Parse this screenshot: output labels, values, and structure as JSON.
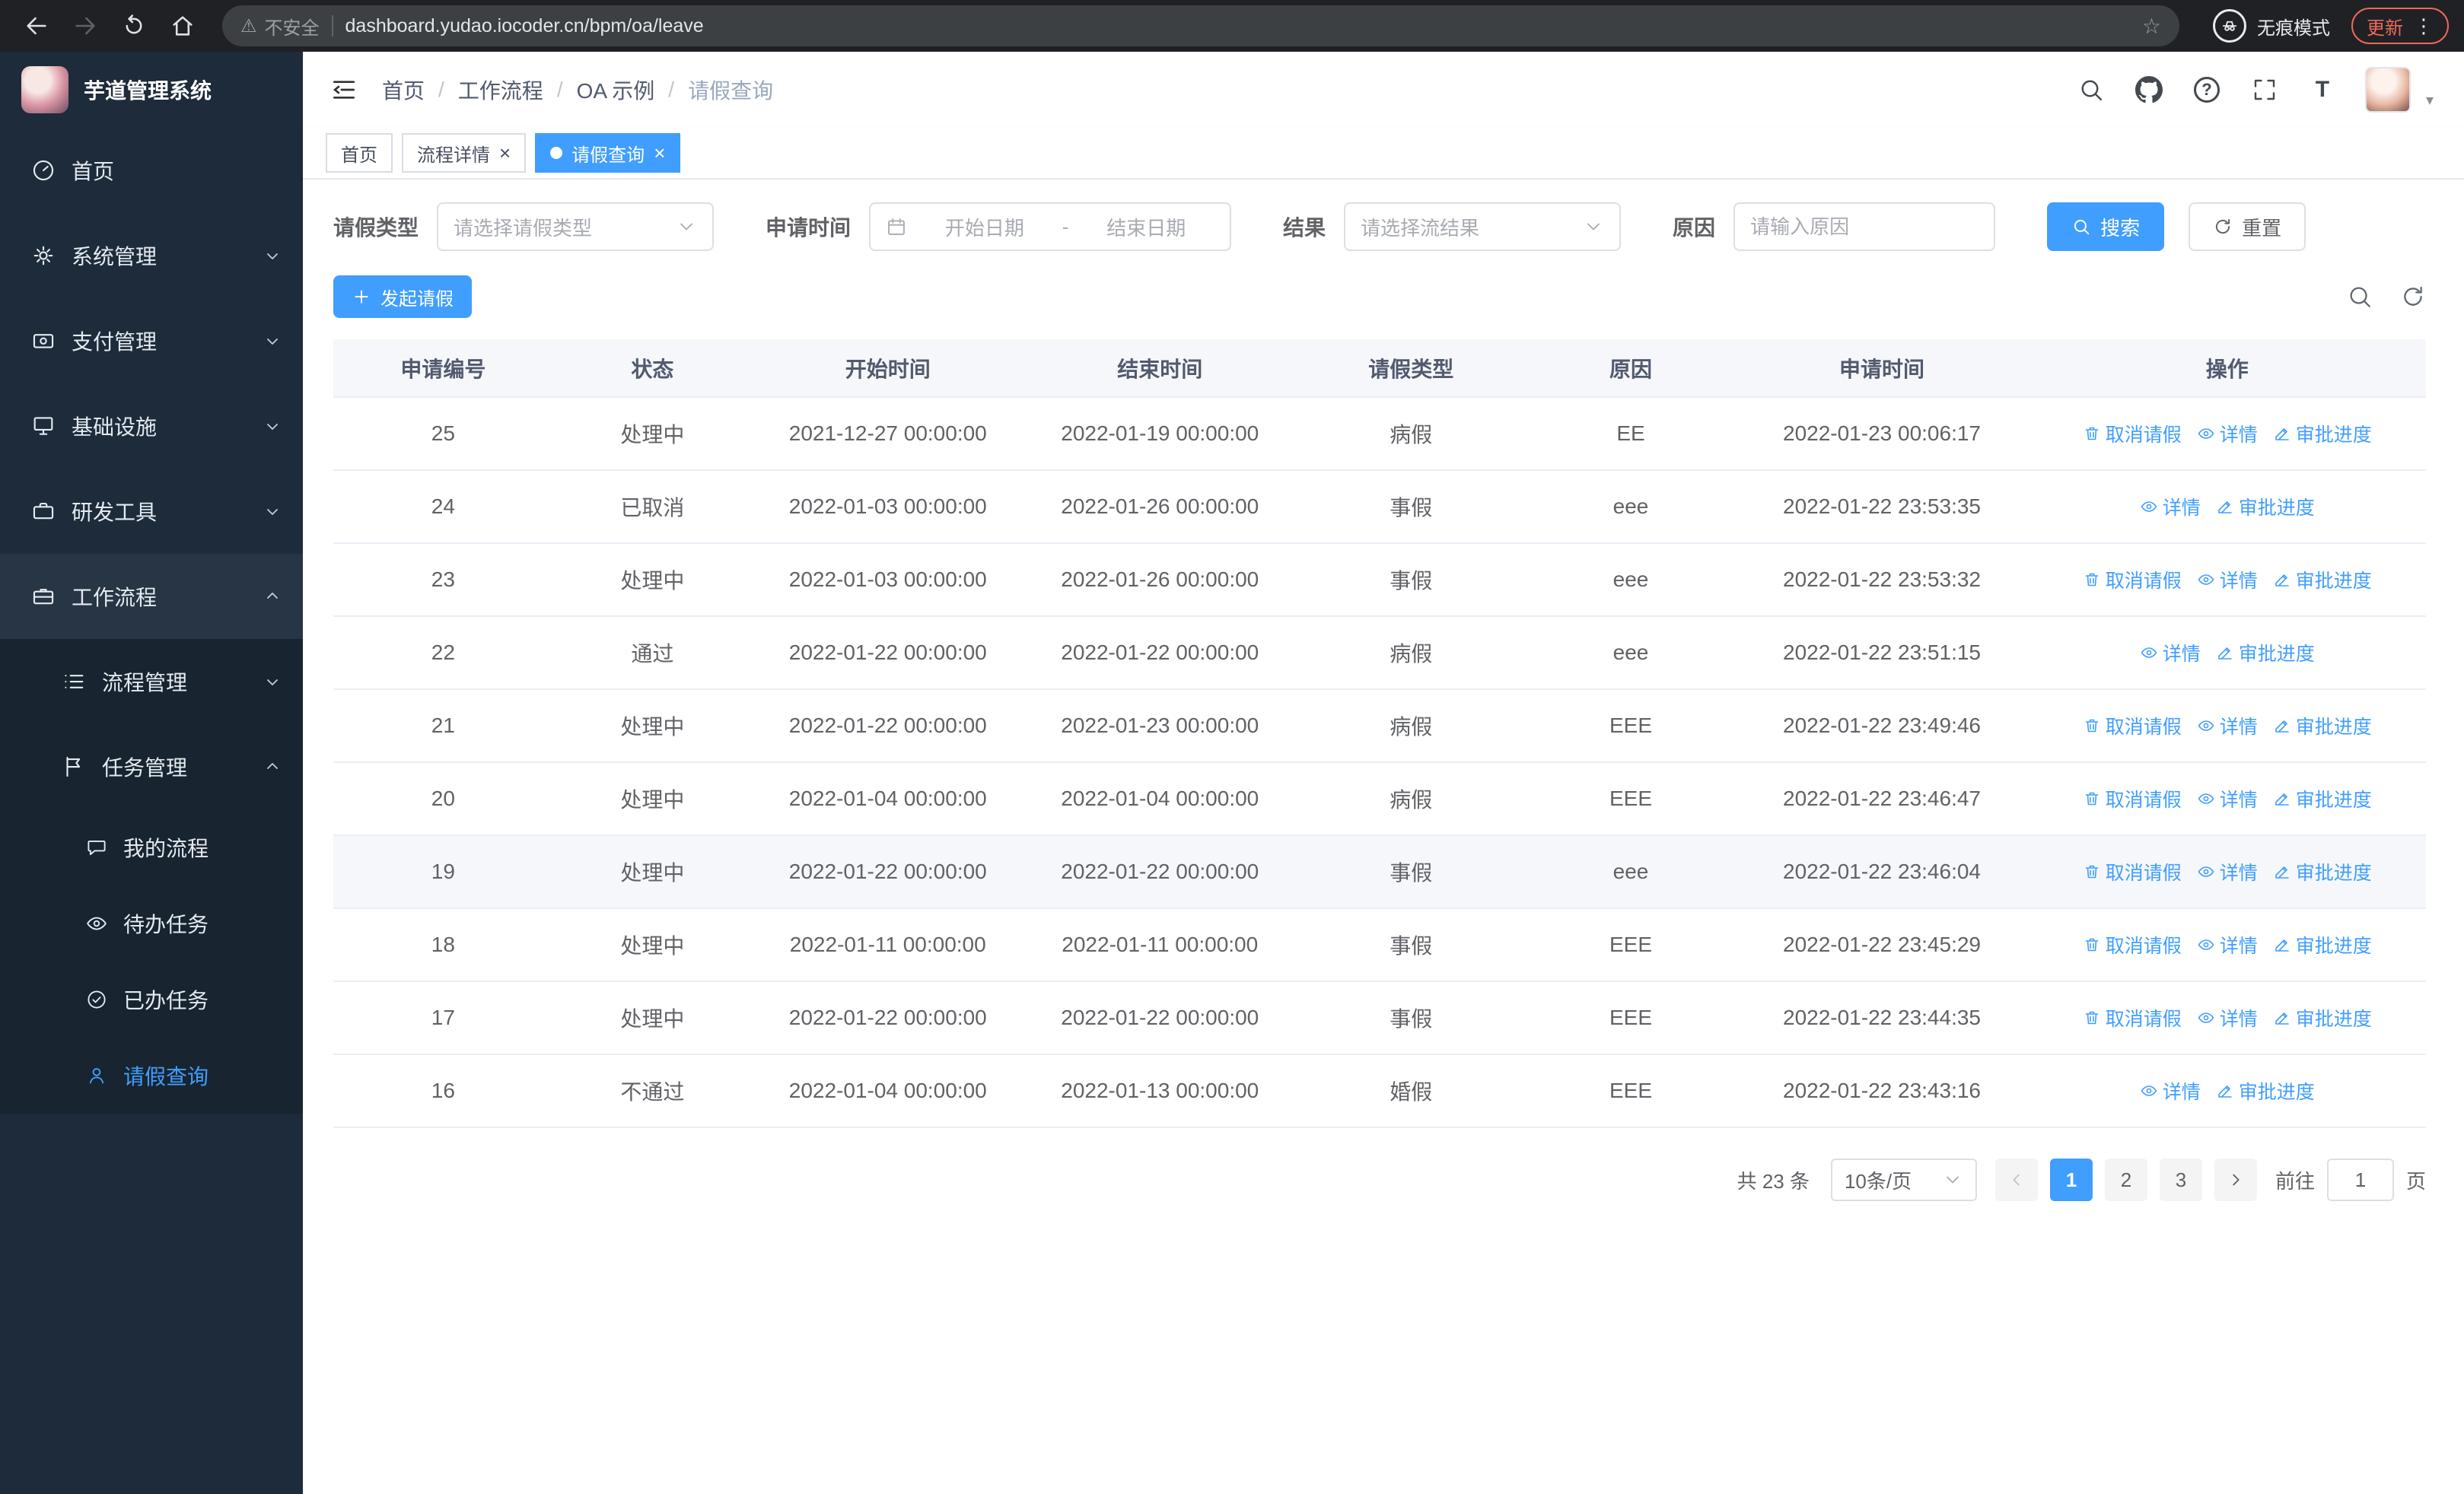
{
  "colors": {
    "primary": "#409eff",
    "sidebar_bg": "#1d2b3a",
    "chrome_bg": "#202124"
  },
  "glyphs": {
    "warning": "⚠",
    "star": "☆",
    "menu_dots": "⋮",
    "help": "?",
    "font_size_icon": "T",
    "avatar_caret": "▾",
    "breadcrumb_separator": "/",
    "tab_close": "×"
  },
  "browser": {
    "security_label": "不安全",
    "url": "dashboard.yudao.iocoder.cn/bpm/oa/leave",
    "incognito_label": "无痕模式",
    "update_label": "更新"
  },
  "sidebar": {
    "logo_title": "芋道管理系统",
    "menu": [
      {
        "label": "首页"
      },
      {
        "label": "系统管理"
      },
      {
        "label": "支付管理"
      },
      {
        "label": "基础设施"
      },
      {
        "label": "研发工具"
      },
      {
        "label": "工作流程"
      }
    ],
    "submenu": [
      {
        "label": "流程管理"
      },
      {
        "label": "任务管理"
      }
    ],
    "leaves": [
      {
        "label": "我的流程"
      },
      {
        "label": "待办任务"
      },
      {
        "label": "已办任务"
      },
      {
        "label": "请假查询"
      }
    ]
  },
  "header": {
    "breadcrumb": [
      "首页",
      "工作流程",
      "OA 示例",
      "请假查询"
    ]
  },
  "tabs": [
    {
      "label": "首页"
    },
    {
      "label": "流程详情"
    },
    {
      "label": "请假查询"
    }
  ],
  "filters": {
    "leave_type_label": "请假类型",
    "leave_type_placeholder": "请选择请假类型",
    "apply_time_label": "申请时间",
    "start_date_placeholder": "开始日期",
    "range_separator": "-",
    "end_date_placeholder": "结束日期",
    "result_label": "结果",
    "result_placeholder": "请选择流结果",
    "reason_label": "原因",
    "reason_placeholder": "请输入原因",
    "search_label": "搜索",
    "reset_label": "重置"
  },
  "toolbar": {
    "create_label": "发起请假"
  },
  "table": {
    "columns": [
      "申请编号",
      "状态",
      "开始时间",
      "结束时间",
      "请假类型",
      "原因",
      "申请时间",
      "操作"
    ],
    "action_defs": {
      "cancel": {
        "label": "取消请假",
        "icon": "cancel-leave-icon"
      },
      "detail": {
        "label": "详情",
        "icon": "detail-eye-icon"
      },
      "progress": {
        "label": "审批进度",
        "icon": "approval-progress-icon"
      }
    },
    "rows": [
      {
        "id": "25",
        "status": "处理中",
        "start": "2021-12-27 00:00:00",
        "end": "2022-01-19 00:00:00",
        "type": "病假",
        "reason": "EE",
        "apply": "2022-01-23 00:06:17",
        "actions": [
          "cancel",
          "detail",
          "progress"
        ],
        "highlight": false
      },
      {
        "id": "24",
        "status": "已取消",
        "start": "2022-01-03 00:00:00",
        "end": "2022-01-26 00:00:00",
        "type": "事假",
        "reason": "eee",
        "apply": "2022-01-22 23:53:35",
        "actions": [
          "detail",
          "progress"
        ],
        "highlight": false
      },
      {
        "id": "23",
        "status": "处理中",
        "start": "2022-01-03 00:00:00",
        "end": "2022-01-26 00:00:00",
        "type": "事假",
        "reason": "eee",
        "apply": "2022-01-22 23:53:32",
        "actions": [
          "cancel",
          "detail",
          "progress"
        ],
        "highlight": false
      },
      {
        "id": "22",
        "status": "通过",
        "start": "2022-01-22 00:00:00",
        "end": "2022-01-22 00:00:00",
        "type": "病假",
        "reason": "eee",
        "apply": "2022-01-22 23:51:15",
        "actions": [
          "detail",
          "progress"
        ],
        "highlight": false
      },
      {
        "id": "21",
        "status": "处理中",
        "start": "2022-01-22 00:00:00",
        "end": "2022-01-23 00:00:00",
        "type": "病假",
        "reason": "EEE",
        "apply": "2022-01-22 23:49:46",
        "actions": [
          "cancel",
          "detail",
          "progress"
        ],
        "highlight": false
      },
      {
        "id": "20",
        "status": "处理中",
        "start": "2022-01-04 00:00:00",
        "end": "2022-01-04 00:00:00",
        "type": "病假",
        "reason": "EEE",
        "apply": "2022-01-22 23:46:47",
        "actions": [
          "cancel",
          "detail",
          "progress"
        ],
        "highlight": false
      },
      {
        "id": "19",
        "status": "处理中",
        "start": "2022-01-22 00:00:00",
        "end": "2022-01-22 00:00:00",
        "type": "事假",
        "reason": "eee",
        "apply": "2022-01-22 23:46:04",
        "actions": [
          "cancel",
          "detail",
          "progress"
        ],
        "highlight": true
      },
      {
        "id": "18",
        "status": "处理中",
        "start": "2022-01-11 00:00:00",
        "end": "2022-01-11 00:00:00",
        "type": "事假",
        "reason": "EEE",
        "apply": "2022-01-22 23:45:29",
        "actions": [
          "cancel",
          "detail",
          "progress"
        ],
        "highlight": false
      },
      {
        "id": "17",
        "status": "处理中",
        "start": "2022-01-22 00:00:00",
        "end": "2022-01-22 00:00:00",
        "type": "事假",
        "reason": "EEE",
        "apply": "2022-01-22 23:44:35",
        "actions": [
          "cancel",
          "detail",
          "progress"
        ],
        "highlight": false
      },
      {
        "id": "16",
        "status": "不通过",
        "start": "2022-01-04 00:00:00",
        "end": "2022-01-13 00:00:00",
        "type": "婚假",
        "reason": "EEE",
        "apply": "2022-01-22 23:43:16",
        "actions": [
          "detail",
          "progress"
        ],
        "highlight": false
      }
    ]
  },
  "pagination": {
    "total_text": "共 23 条",
    "page_size": "10条/页",
    "pages": [
      "1",
      "2",
      "3"
    ],
    "active_page": "1",
    "goto_label": "前往",
    "goto_value": "1",
    "page_unit_label": "页"
  }
}
